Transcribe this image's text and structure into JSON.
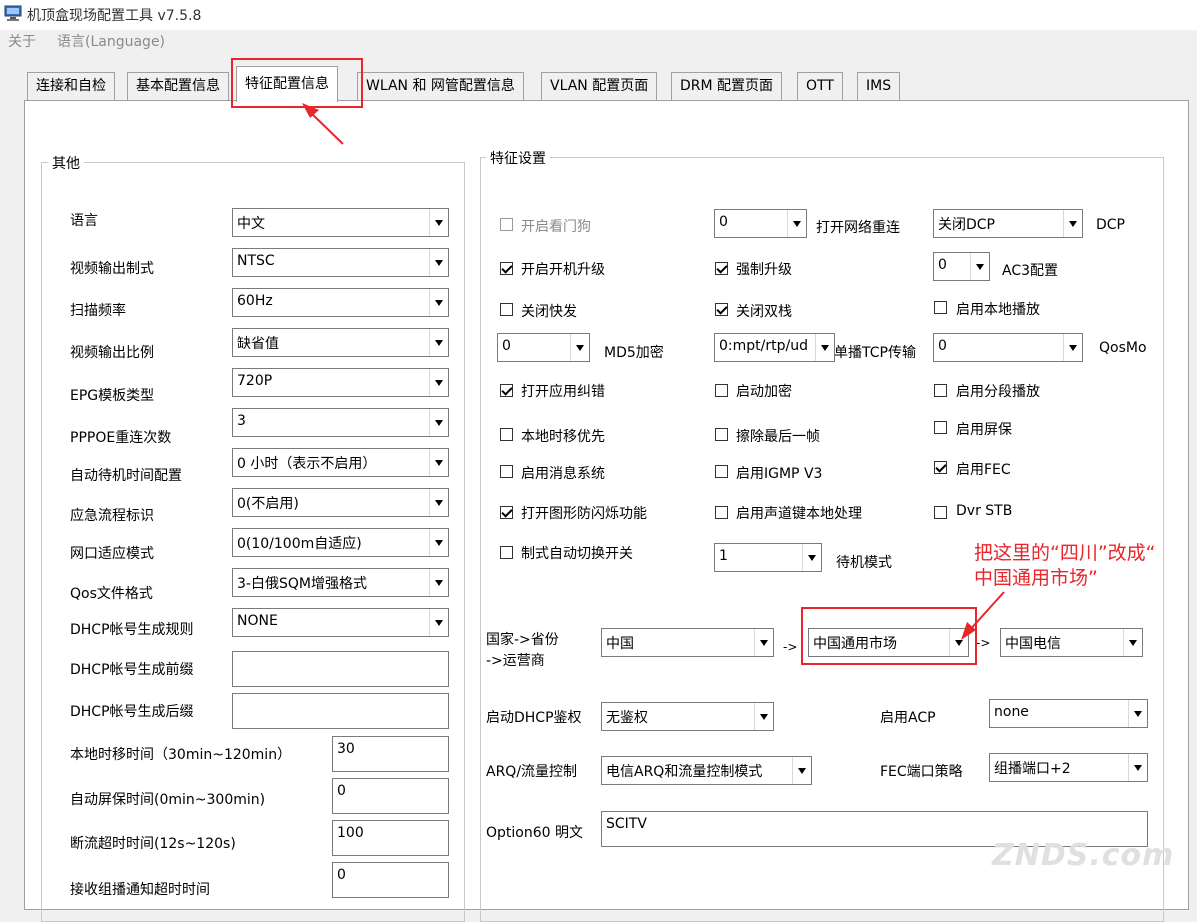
{
  "window": {
    "title": "机顶盒现场配置工具 v7.5.8",
    "menu": [
      "关于",
      "语言(Language)"
    ]
  },
  "tabs": [
    "连接和自检",
    "基本配置信息",
    "特征配置信息",
    "WLAN 和 网管配置信息",
    "VLAN 配置页面",
    "DRM 配置页面",
    "OTT",
    "IMS"
  ],
  "active_tab": "特征配置信息",
  "left_group": {
    "title": "其他",
    "combo_rows": [
      {
        "label": "语言",
        "value": "中文"
      },
      {
        "label": "视频输出制式",
        "value": "NTSC"
      },
      {
        "label": "扫描频率",
        "value": "60Hz"
      },
      {
        "label": "视频输出比例",
        "value": "缺省值"
      },
      {
        "label": "EPG模板类型",
        "value": "720P"
      },
      {
        "label": "PPPOE重连次数",
        "value": "3"
      },
      {
        "label": "自动待机时间配置",
        "value": "0 小时（表示不启用）"
      },
      {
        "label": "应急流程标识",
        "value": "0(不启用)"
      },
      {
        "label": "网口适应模式",
        "value": "0(10/100m自适应)"
      },
      {
        "label": "Qos文件格式",
        "value": "3-白俄SQM增强格式"
      },
      {
        "label": "DHCP帐号生成规则",
        "value": "NONE"
      }
    ],
    "text_rows": [
      {
        "label": "DHCP帐号生成前缀",
        "value": ""
      },
      {
        "label": "DHCP帐号生成后缀",
        "value": ""
      }
    ],
    "time_rows": [
      {
        "label": "本地时移时间（30min~120min）",
        "value": "30"
      },
      {
        "label": "自动屏保时间(0min~300min)",
        "value": "0"
      },
      {
        "label": "断流超时时间(12s~120s)",
        "value": "100"
      },
      {
        "label": "接收组播通知超时时间",
        "value": "0"
      }
    ]
  },
  "right_group": {
    "title": "特征设置",
    "checkboxes": [
      {
        "label": "开启看门狗",
        "checked": false,
        "disabled": true
      },
      {
        "label": "开启开机升级",
        "checked": true
      },
      {
        "label": "强制升级",
        "checked": true
      },
      {
        "label": "关闭快发",
        "checked": false
      },
      {
        "label": "关闭双栈",
        "checked": true
      },
      {
        "label": "启用本地播放",
        "checked": false
      },
      {
        "label": "打开应用纠错",
        "checked": true
      },
      {
        "label": "启动加密",
        "checked": false
      },
      {
        "label": "启用分段播放",
        "checked": false
      },
      {
        "label": "本地时移优先",
        "checked": false
      },
      {
        "label": "擦除最后一帧",
        "checked": false
      },
      {
        "label": "启用屏保",
        "checked": false
      },
      {
        "label": "启用消息系统",
        "checked": false
      },
      {
        "label": "启用IGMP V3",
        "checked": false
      },
      {
        "label": "启用FEC",
        "checked": true
      },
      {
        "label": "打开图形防闪烁功能",
        "checked": true
      },
      {
        "label": "启用声道键本地处理",
        "checked": false
      },
      {
        "label": "Dvr STB",
        "checked": false
      },
      {
        "label": "制式自动切换开关",
        "checked": false
      }
    ],
    "combos": {
      "reconnect": {
        "value": "0",
        "label": "打开网络重连"
      },
      "dcp": {
        "value": "关闭DCP",
        "label": "DCP"
      },
      "ac3": {
        "value": "0",
        "label": "AC3配置"
      },
      "md5": {
        "value": "0",
        "label": "MD5加密"
      },
      "tcp": {
        "value": "0:mpt/rtp/ud",
        "label": "单播TCP传输"
      },
      "qos": {
        "value": "0",
        "label": "QosMo"
      },
      "standby": {
        "value": "1",
        "label": "待机模式"
      }
    },
    "region": {
      "label_line1": "国家->省份",
      "label_line2": "->运营商",
      "country": "中国",
      "province": "中国通用市场",
      "operator": "中国电信",
      "arrow": "->"
    },
    "dhcp_auth": {
      "label": "启动DHCP鉴权",
      "value": "无鉴权"
    },
    "acp": {
      "label": "启用ACP",
      "value": "none"
    },
    "arq": {
      "label": "ARQ/流量控制",
      "value": "电信ARQ和流量控制模式"
    },
    "fec_port": {
      "label": "FEC端口策略",
      "value": "组播端口+2"
    },
    "option60": {
      "label": "Option60 明文",
      "value": "SCITV"
    }
  },
  "annotation": {
    "line1": "把这里的“四川”改成“",
    "line2": "中国通用市场”",
    "color": "#e8262b"
  },
  "watermark": "ZNDS.com"
}
